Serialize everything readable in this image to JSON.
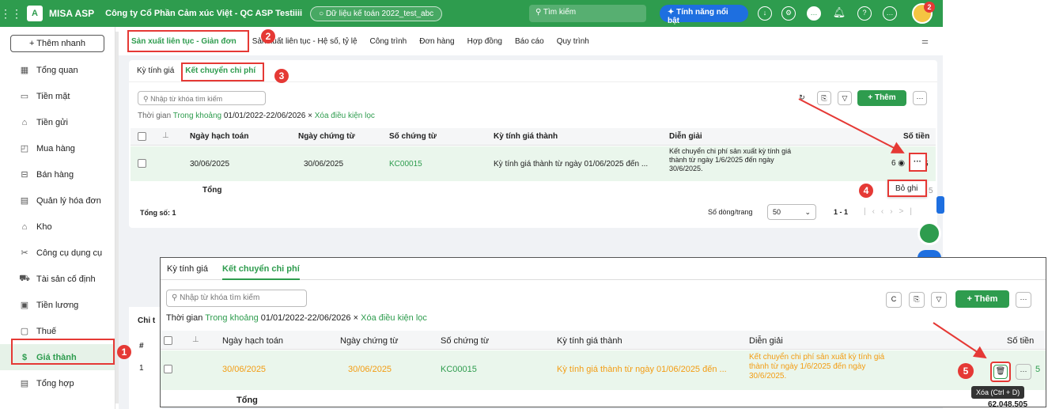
{
  "topbar": {
    "app_name": "MISA ASP",
    "company": "Công ty Cổ Phần Cảm xúc Việt - QC ASP Testiiii",
    "database": "Dữ liệu kế toán 2022_test_abc",
    "search_placeholder": "Tìm kiếm",
    "feature_label": "Tính năng nổi bật",
    "notify_count": "2"
  },
  "sidebar": {
    "add_label": "+ Thêm nhanh",
    "items": [
      {
        "label": "Tổng quan",
        "icon": "dashboard-icon"
      },
      {
        "label": "Tiền mặt",
        "icon": "cash-icon"
      },
      {
        "label": "Tiền gửi",
        "icon": "bank-icon"
      },
      {
        "label": "Mua hàng",
        "icon": "bag-icon"
      },
      {
        "label": "Bán hàng",
        "icon": "cart-icon"
      },
      {
        "label": "Quản lý hóa đơn",
        "icon": "invoice-icon"
      },
      {
        "label": "Kho",
        "icon": "warehouse-icon"
      },
      {
        "label": "Công cụ dụng cụ",
        "icon": "tools-icon"
      },
      {
        "label": "Tài sản cố định",
        "icon": "asset-icon"
      },
      {
        "label": "Tiền lương",
        "icon": "salary-icon"
      },
      {
        "label": "Thuế",
        "icon": "tax-icon"
      },
      {
        "label": "Giá thành",
        "icon": "cost-icon"
      },
      {
        "label": "Tổng hợp",
        "icon": "summary-icon"
      }
    ]
  },
  "top_tabs": [
    "Sản xuất liên tục - Giản đơn",
    "Sản xuất liên tục - Hệ số, tỷ lệ",
    "Công trình",
    "Đơn hàng",
    "Hợp đồng",
    "Báo cáo",
    "Quy trình"
  ],
  "sub_tabs": [
    "Kỳ tính giá",
    "Kết chuyển chi phí"
  ],
  "search_placeholder": "Nhập từ khóa tìm kiếm",
  "filter": {
    "label": "Thời gian",
    "mode": "Trong khoảng",
    "range": "01/01/2022-22/06/2026",
    "clear_x": "×",
    "clear": "Xóa điều kiện lọc"
  },
  "add_button": "+ Thêm",
  "more": "···",
  "columns": [
    "Ngày hạch toán",
    "Ngày chứng từ",
    "Số chứng từ",
    "Kỳ tính giá thành",
    "Diễn giải",
    "Số tiền"
  ],
  "row": {
    "post_date": "30/06/2025",
    "doc_date": "30/06/2025",
    "doc_no": "KC00015",
    "period": "Kỳ tính giá thành từ ngày 01/06/2025 đến ...",
    "desc_l1": "Kết chuyển chi phí sản xuất kỳ tính giá",
    "desc_l2": "thành từ ngày 1/6/2025 đến ngày",
    "desc_l3": "30/6/2025.",
    "amount_tail": "5"
  },
  "total_label": "Tổng",
  "total_amount": "62.048.505",
  "footer": {
    "total_count": "Tổng số: 1",
    "rows_per_page_label": "Số dòng/trang",
    "rows_per_page": "50",
    "range": "1 - 1"
  },
  "popup_label": "Bỏ ghi",
  "tooltip_label": "Xóa (Ctrl + D)",
  "partial_text": "Chi t",
  "table2_hash": "#",
  "table2_row1": "1",
  "steps": [
    "1",
    "2",
    "3",
    "4",
    "5"
  ]
}
